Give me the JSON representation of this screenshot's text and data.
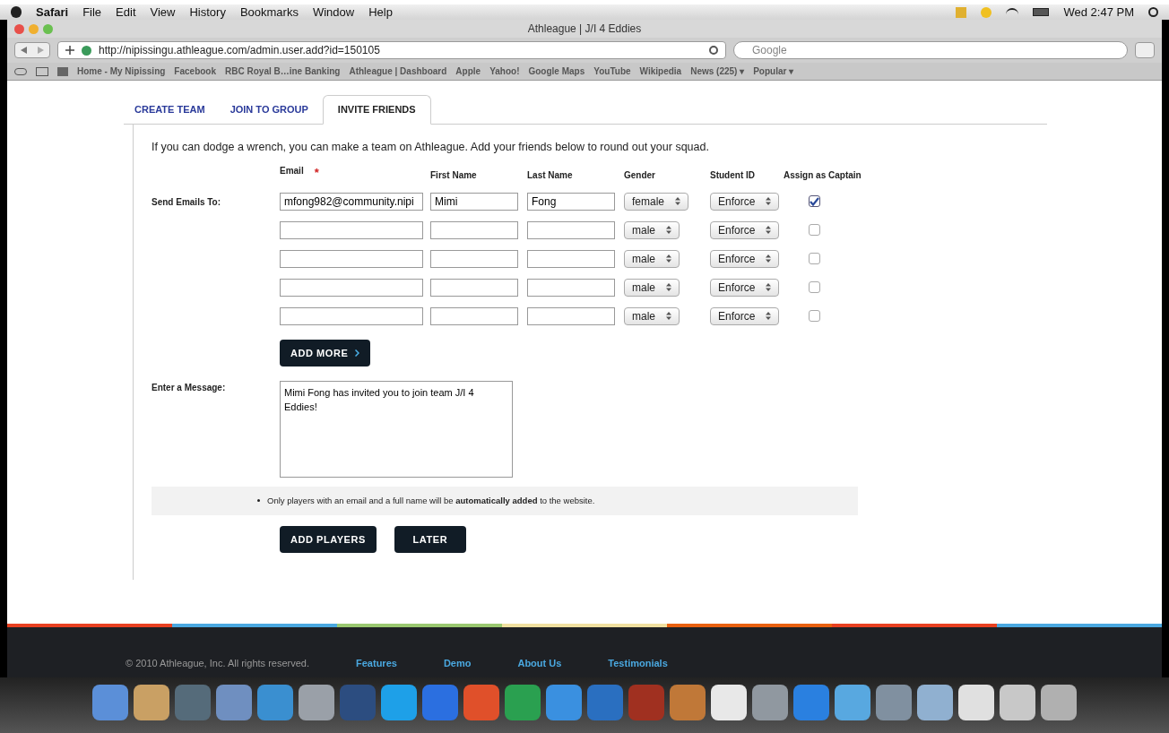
{
  "menu_bar": {
    "app": "Safari",
    "items": [
      "File",
      "Edit",
      "View",
      "History",
      "Bookmarks",
      "Window",
      "Help"
    ],
    "clock": "Wed 2:47 PM"
  },
  "window": {
    "title": "Athleague | J/I 4 Eddies"
  },
  "address_bar": {
    "url": "http://nipissingu.athleague.com/admin.user.add?id=150105"
  },
  "search": {
    "placeholder": "Google"
  },
  "bookmarks": [
    "Home - My Nipissing",
    "Facebook",
    "RBC Royal B…ine Banking",
    "Athleague | Dashboard",
    "Apple",
    "Yahoo!",
    "Google Maps",
    "YouTube",
    "Wikipedia",
    "News (225) ▾",
    "Popular ▾"
  ],
  "tabs": [
    {
      "label": "CREATE TEAM",
      "selected": false
    },
    {
      "label": "JOIN TO GROUP",
      "selected": false
    },
    {
      "label": "INVITE FRIENDS",
      "selected": true
    }
  ],
  "intro": "If you can dodge a wrench, you can make a team on Athleague. Add your friends below to round out your squad.",
  "columns": {
    "email": "Email",
    "required": "*",
    "first_name": "First Name",
    "last_name": "Last Name",
    "gender": "Gender",
    "student_id": "Student ID",
    "captain": "Assign as Captain"
  },
  "send_label": "Send Emails To:",
  "rows": [
    {
      "email": "mfong982@community.nipi",
      "first_name": "Mimi",
      "last_name": "Fong",
      "gender": "female",
      "student_id": "Enforce",
      "captain": true
    },
    {
      "email": "",
      "first_name": "",
      "last_name": "",
      "gender": "male",
      "student_id": "Enforce",
      "captain": false
    },
    {
      "email": "",
      "first_name": "",
      "last_name": "",
      "gender": "male",
      "student_id": "Enforce",
      "captain": false
    },
    {
      "email": "",
      "first_name": "",
      "last_name": "",
      "gender": "male",
      "student_id": "Enforce",
      "captain": false
    },
    {
      "email": "",
      "first_name": "",
      "last_name": "",
      "gender": "male",
      "student_id": "Enforce",
      "captain": false
    }
  ],
  "add_more": "ADD MORE",
  "message_label": "Enter a Message:",
  "message": "Mimi Fong has invited you to join team J/I 4 Eddies!",
  "note": "Only players with an email and a full name will be **automatically added** to the website.",
  "buttons": [
    "ADD PLAYERS",
    "LATER"
  ],
  "footer": {
    "copyright": "© 2010 Athleague, Inc. All rights reserved.",
    "links": [
      "Features",
      "Demo",
      "About Us",
      "Testimonials"
    ]
  }
}
